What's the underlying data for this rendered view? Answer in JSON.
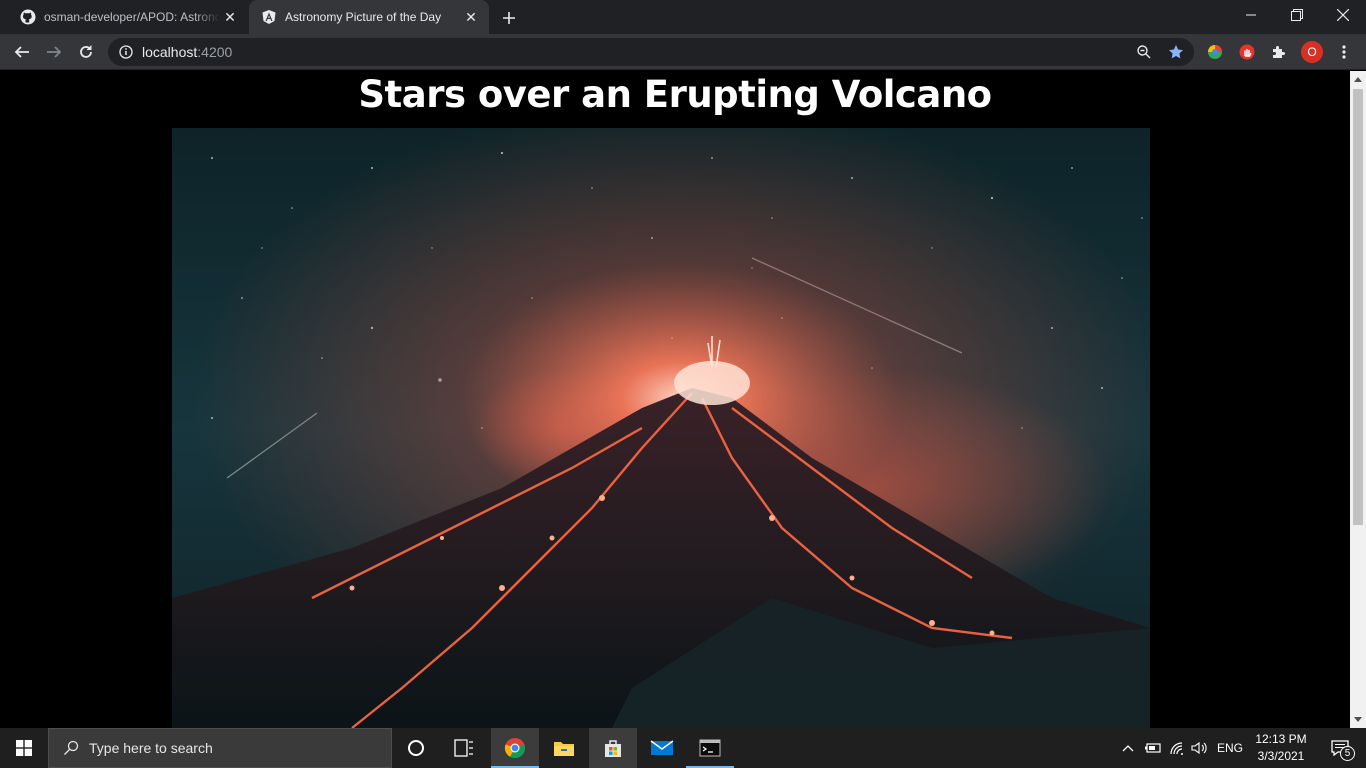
{
  "browser": {
    "tabs": [
      {
        "title": "osman-developer/APOD: Astronomy Picture of the Day",
        "icon": "github-icon",
        "active": false
      },
      {
        "title": "Astronomy Picture of the Day",
        "icon": "angular-icon",
        "active": true
      }
    ],
    "address_bar": {
      "host": "localhost",
      "port": ":4200"
    },
    "profile_initial": "O"
  },
  "page": {
    "title": "Stars over an Erupting Volcano",
    "image": {
      "subject": "erupting-volcano-night-sky",
      "colors": {
        "sky": "#16343c",
        "lava": "#ff5a3c",
        "glow": "#ffb39a"
      }
    }
  },
  "taskbar": {
    "search_placeholder": "Type here to search",
    "language": "ENG",
    "time": "12:13 PM",
    "date": "3/3/2021",
    "notification_count": "5",
    "pinned": [
      "cortana-icon",
      "task-view-icon",
      "chrome-icon",
      "file-explorer-icon",
      "microsoft-store-icon",
      "mail-icon",
      "terminal-icon"
    ]
  },
  "colors": {
    "chrome_dark": "#202124",
    "chrome_toolbar": "#35363a",
    "taskbar": "#1f1f1f",
    "accent": "#76b9ed"
  }
}
